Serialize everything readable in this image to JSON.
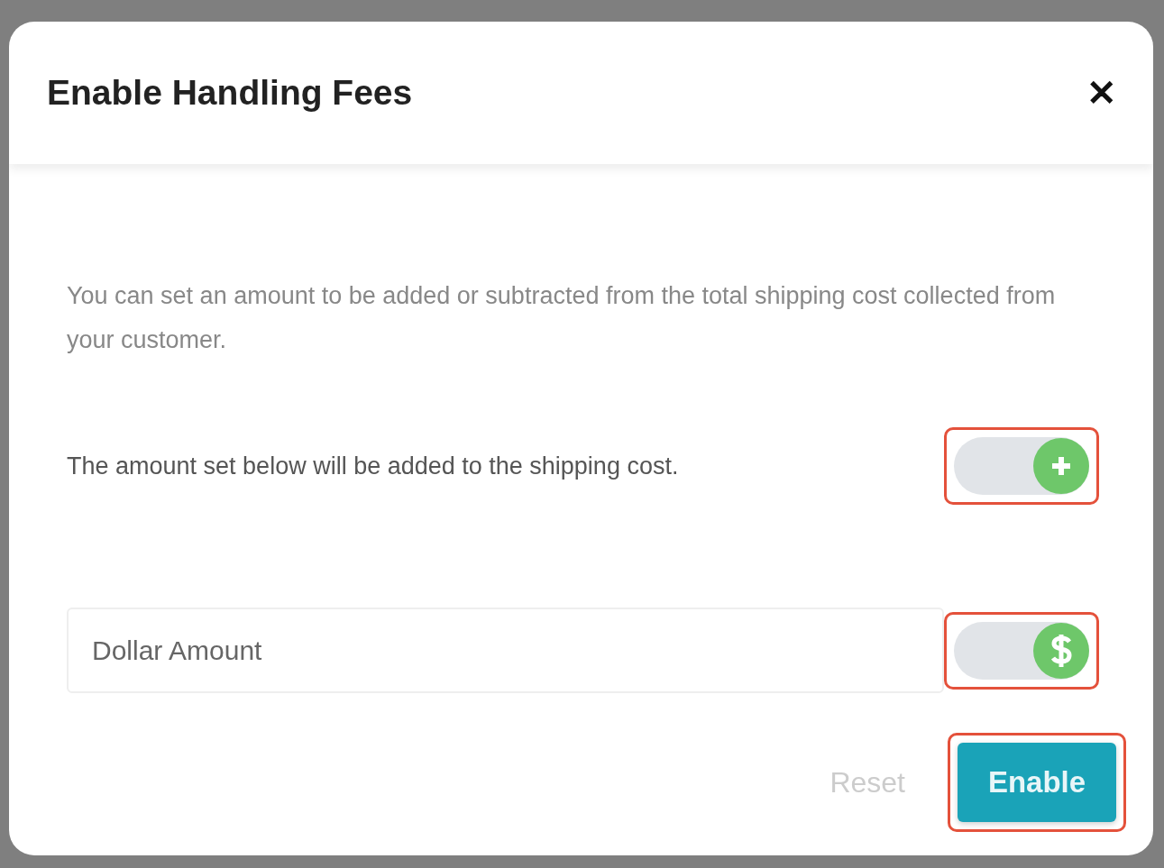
{
  "dialog": {
    "title": "Enable Handling Fees",
    "close": "✕"
  },
  "description": "You can set an amount to be added or subtracted from the total shipping cost collected from your customer.",
  "fee_toggle": {
    "label": "The amount set below will be added to the shipping cost.",
    "on": true,
    "kind": "plus",
    "highlighted": true
  },
  "amount": {
    "placeholder": "Dollar Amount",
    "toggle": {
      "on": true,
      "kind": "dollar",
      "highlighted": true
    }
  },
  "buttons": [
    {
      "label": "Reset",
      "kind": "text",
      "disabled": true,
      "highlighted": false
    },
    {
      "label": "Enable",
      "kind": "primary",
      "disabled": false,
      "highlighted": true
    }
  ]
}
